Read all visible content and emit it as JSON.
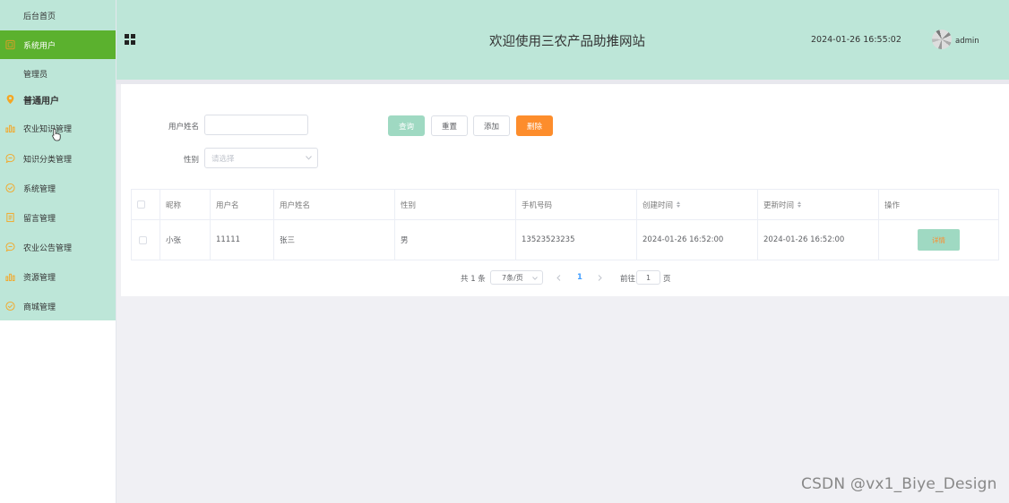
{
  "sidebar": {
    "items": [
      {
        "label": "后台首页",
        "icon": "none"
      },
      {
        "label": "系统用户",
        "icon": "grid-icon",
        "active": true
      },
      {
        "label": "管理员",
        "icon": "none"
      },
      {
        "label": "普通用户",
        "icon": "location-pin-icon"
      },
      {
        "label": "农业知识管理",
        "icon": "bar-chart-icon"
      },
      {
        "label": "知识分类管理",
        "icon": "chat-bubble-icon"
      },
      {
        "label": "系统管理",
        "icon": "check-circle-icon"
      },
      {
        "label": "留言管理",
        "icon": "document-icon"
      },
      {
        "label": "农业公告管理",
        "icon": "chat-bubble-icon"
      },
      {
        "label": "资源管理",
        "icon": "bar-chart-icon"
      },
      {
        "label": "商城管理",
        "icon": "check-circle-icon"
      }
    ]
  },
  "header": {
    "title": "欢迎使用三农产品助推网站",
    "datetime": "2024-01-26 16:55:02",
    "username": "admin"
  },
  "search": {
    "name_label": "用户姓名",
    "name_value": "",
    "gender_label": "性别",
    "gender_placeholder": "请选择",
    "query_label": "查询",
    "reset_label": "重置",
    "add_label": "添加",
    "delete_label": "删除"
  },
  "table": {
    "headers": [
      "昵称",
      "用户名",
      "用户姓名",
      "性别",
      "手机号码",
      "创建时间",
      "更新时间",
      "操作"
    ],
    "rows": [
      {
        "nickname": "小张",
        "username": "11111",
        "realname": "张三",
        "gender": "男",
        "phone": "13523523235",
        "created": "2024-01-26 16:52:00",
        "updated": "2024-01-26 16:52:00",
        "action": "详情"
      }
    ]
  },
  "pagination": {
    "total": "共 1 条",
    "page_size": "7条/页",
    "current_page": "1",
    "goto_label": "前往",
    "goto_value": "1",
    "page_suffix": "页"
  },
  "watermark": "CSDN @vx1_Biye_Design",
  "colors": {
    "sidebar_bg": "#bde6d8",
    "active_item": "#5bb12e",
    "query_button": "#9fd9c2",
    "delete_button": "#fd8d2c",
    "icon_orange": "#f5a623"
  }
}
